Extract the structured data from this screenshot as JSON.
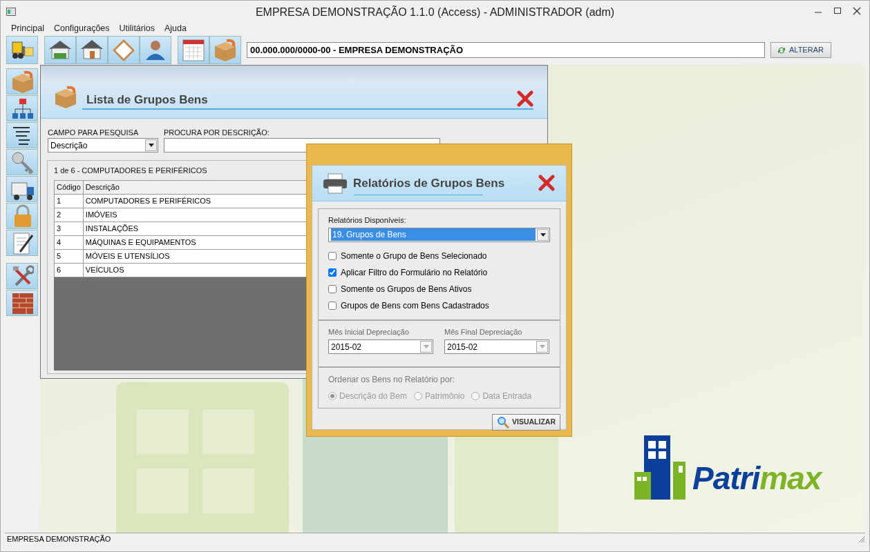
{
  "window": {
    "title": "EMPRESA DEMONSTRAÇÃO 1.1.0 (Access) - ADMINISTRADOR (adm)"
  },
  "menu": [
    "Principal",
    "Configurações",
    "Utilitários",
    "Ajuda"
  ],
  "company": {
    "value": "00.000.000/0000-00 - EMPRESA DEMONSTRAÇÃO",
    "button": "ALTERAR"
  },
  "list_window": {
    "title": "Lista de Grupos Bens",
    "field_label": "CAMPO PARA PESQUISA",
    "field_value": "Descrição",
    "search_label": "PROCURA POR DESCRIÇÃO:",
    "caption": "1 de 6 - COMPUTADORES E PERIFÉRICOS",
    "columns": [
      "Código",
      "Descrição"
    ],
    "rows": [
      [
        "1",
        "COMPUTADORES E PERIFÉRICOS"
      ],
      [
        "2",
        "IMÓVEIS"
      ],
      [
        "3",
        "INSTALAÇÕES"
      ],
      [
        "4",
        "MÁQUINAS E EQUIPAMENTOS"
      ],
      [
        "5",
        "MÓVEIS E UTENSÍLIOS"
      ],
      [
        "6",
        "VEÍCULOS"
      ]
    ]
  },
  "report_dialog": {
    "title": "Relatórios de Grupos Bens",
    "reports_label": "Relatórios Disponíveis:",
    "report_value": "19. Grupos de Bens",
    "options": [
      {
        "label": "Somente o Grupo de Bens Selecionado",
        "checked": false
      },
      {
        "label": "Aplicar Filtro do Formulário no Relatório",
        "checked": true
      },
      {
        "label": "Somente os Grupos de Bens Ativos",
        "checked": false
      },
      {
        "label": "Grupos de Bens com Bens Cadastrados",
        "checked": false
      }
    ],
    "month_start": {
      "label": "Mês Inicial Depreciação",
      "value": "2015-02"
    },
    "month_end": {
      "label": "Mês Final Depreciação",
      "value": "2015-02"
    },
    "sort": {
      "label": "Ordenar os Bens no Relatório por:",
      "disabled": true,
      "options": [
        {
          "label": "Descrição do Bem",
          "selected": true
        },
        {
          "label": "Patrimônio",
          "selected": false
        },
        {
          "label": "Data Entrada",
          "selected": false
        }
      ]
    },
    "button": "VISUALIZAR"
  },
  "logo": {
    "text_primary": "Patri",
    "text_secondary": "max"
  },
  "status_bar": "EMPRESA DEMONSTRAÇÃO"
}
